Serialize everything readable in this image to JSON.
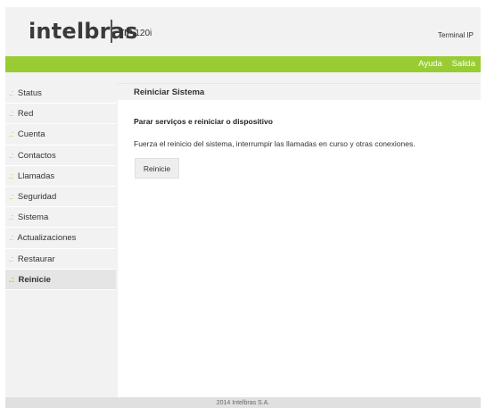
{
  "header": {
    "logo_text": "intelbras",
    "model_prefix": "TIP",
    "model_number": "120i",
    "device_type": "Terminal IP"
  },
  "top_links": [
    "Ayuda",
    "Salida"
  ],
  "sidebar": {
    "prefix": ".:",
    "items": [
      "Status",
      "Red",
      "Cuenta",
      "Contactos",
      "Llamadas",
      "Seguridad",
      "Sistema",
      "Actualizaciones",
      "Restaurar",
      "Reinicie"
    ],
    "active": "Reinicie"
  },
  "main": {
    "title": "Reiniciar Sistema",
    "section_title": "Parar serviços e reiniciar o dispositivo",
    "description": "Fuerza el reinicio del sistema, interrumpir las llamadas en curso y otras conexiones.",
    "button_label": "Reinicie"
  },
  "footer": {
    "text": "2014 Intelbras S.A."
  },
  "colors": {
    "accent": "#99cc33",
    "background": "#f2f2f2"
  }
}
